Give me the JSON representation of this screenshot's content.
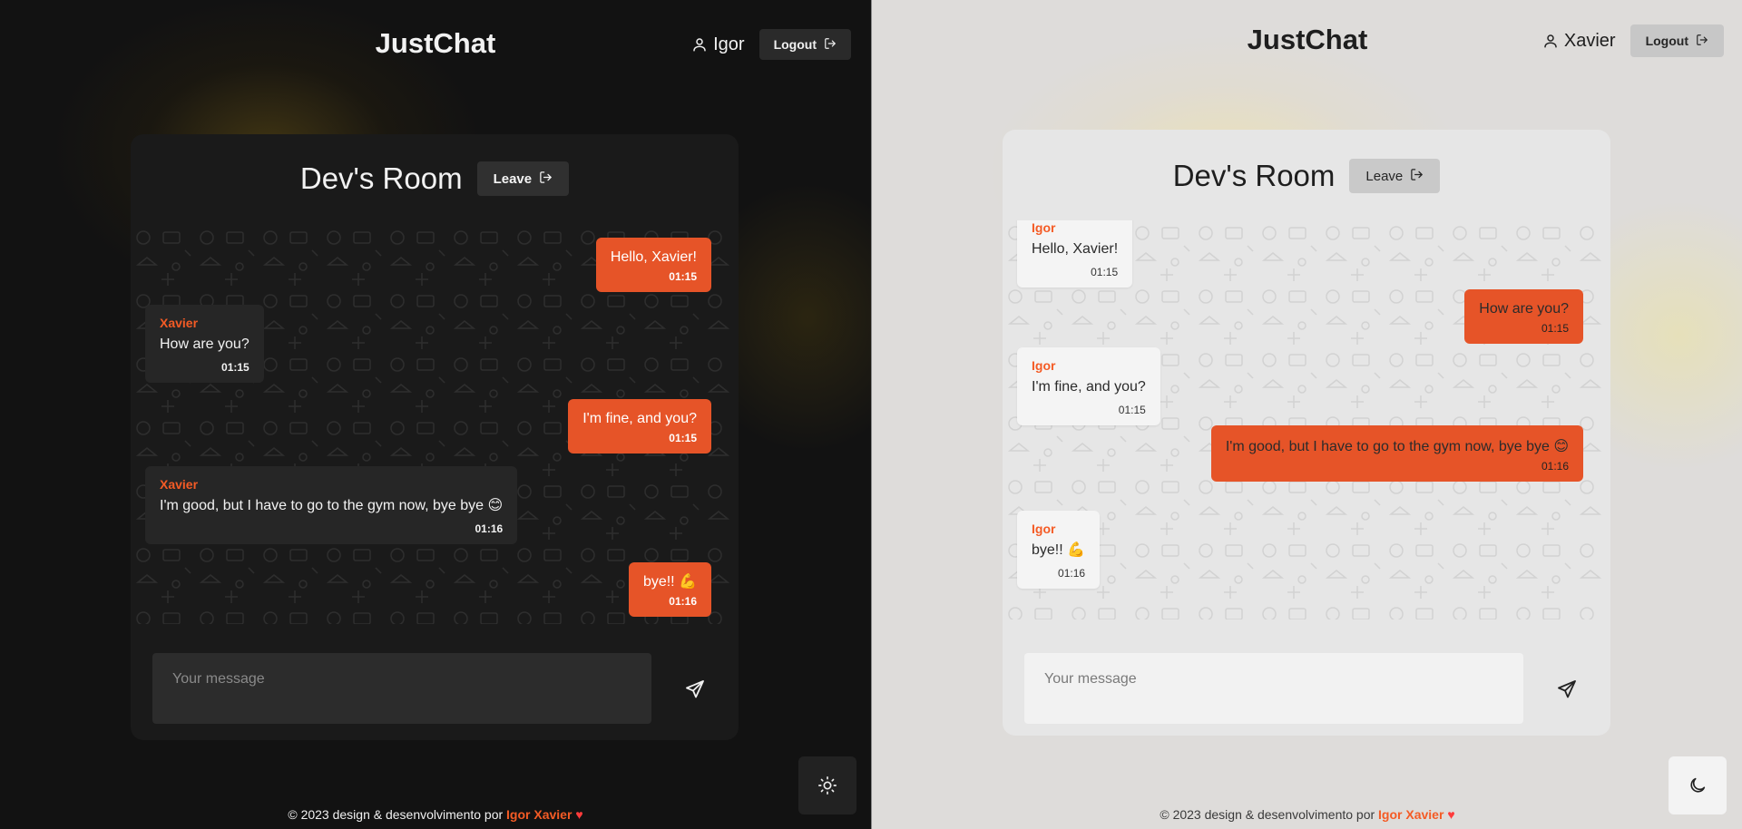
{
  "colors": {
    "accent": "#E65428",
    "sender_name": "#F45B25",
    "dark_bg": "#121212",
    "light_bg": "#DEDCDA",
    "heart": "#FF3B3B"
  },
  "app_title": "JustChat",
  "room_title": "Dev's Room",
  "leave_label": "Leave",
  "logout_label": "Logout",
  "composer_placeholder": "Your message",
  "footer": {
    "text": "© 2023 design & desenvolvimento por",
    "author": "Igor Xavier",
    "heart": "♥"
  },
  "panes": [
    {
      "theme": "dark",
      "current_user": "Igor",
      "theme_toggle_icon": "sun-icon",
      "messages": [
        {
          "sender": "",
          "text": "Hello, Xavier!",
          "time": "01:15",
          "own": true
        },
        {
          "sender": "Xavier",
          "text": "How are you?",
          "time": "01:15",
          "own": false
        },
        {
          "sender": "",
          "text": "I'm fine, and you?",
          "time": "01:15",
          "own": true
        },
        {
          "sender": "Xavier",
          "text": "I'm good, but I have to go to the gym now, bye bye 😊",
          "time": "01:16",
          "own": false
        },
        {
          "sender": "",
          "text": "bye!! 💪",
          "time": "01:16",
          "own": true
        }
      ]
    },
    {
      "theme": "light",
      "current_user": "Xavier",
      "theme_toggle_icon": "moon-icon",
      "messages": [
        {
          "sender": "Igor",
          "text": "Hello, Xavier!",
          "time": "01:15",
          "own": false
        },
        {
          "sender": "",
          "text": "How are you?",
          "time": "01:15",
          "own": true
        },
        {
          "sender": "Igor",
          "text": "I'm fine, and you?",
          "time": "01:15",
          "own": false
        },
        {
          "sender": "",
          "text": "I'm good, but I have to go to the gym now, bye bye 😊",
          "time": "01:16",
          "own": true
        },
        {
          "sender": "Igor",
          "text": "bye!! 💪",
          "time": "01:16",
          "own": false
        }
      ]
    }
  ]
}
